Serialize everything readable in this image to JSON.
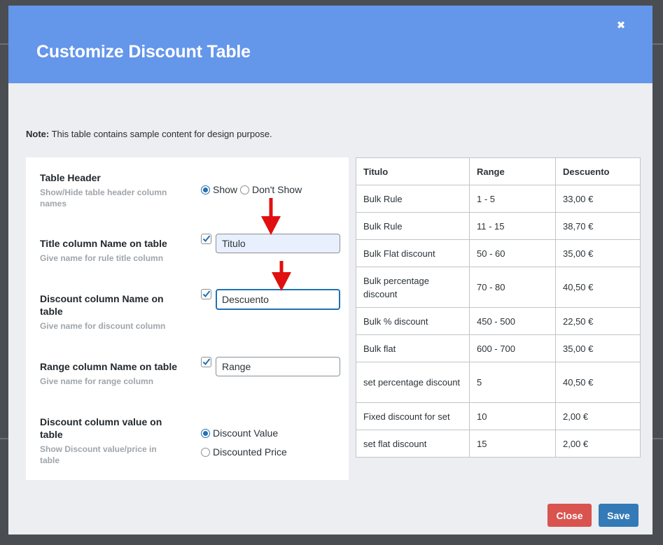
{
  "modal": {
    "title": "Customize Discount Table",
    "note_prefix": "Note:",
    "note_text": " This table contains sample content for design purpose."
  },
  "settings": {
    "table_header": {
      "label": "Table Header",
      "desc": "Show/Hide table header column names",
      "option_show": "Show",
      "option_dont_show": "Don't Show",
      "selected": "Show"
    },
    "title_column": {
      "label": "Title column Name on table",
      "desc": "Give name for rule title column",
      "checked": true,
      "value": "Titulo"
    },
    "discount_column": {
      "label": "Discount column Name on table",
      "desc": "Give name for discount column",
      "checked": true,
      "value": "Descuento"
    },
    "range_column": {
      "label": "Range column Name on table",
      "desc": "Give name for range column",
      "checked": true,
      "value": "Range"
    },
    "discount_value": {
      "label": "Discount column value on table",
      "desc": "Show Discount value/price in table",
      "option_value": "Discount Value",
      "option_price": "Discounted Price",
      "selected": "Discount Value"
    }
  },
  "preview": {
    "headers": [
      "Titulo",
      "Range",
      "Descuento"
    ],
    "rows": [
      [
        "Bulk Rule",
        "1 - 5",
        "33,00 €"
      ],
      [
        "Bulk Rule",
        "11 - 15",
        "38,70 €"
      ],
      [
        "Bulk Flat discount",
        "50 - 60",
        "35,00 €"
      ],
      [
        "Bulk percentage discount",
        "70 - 80",
        "40,50 €"
      ],
      [
        "Bulk % discount",
        "450 - 500",
        "22,50 €"
      ],
      [
        "Bulk flat",
        "600 - 700",
        "35,00 €"
      ],
      [
        "set percentage discount",
        "5",
        "40,50 €"
      ],
      [
        "Fixed discount for set",
        "10",
        "2,00 €"
      ],
      [
        "set flat discount",
        "15",
        "2,00 €"
      ]
    ]
  },
  "buttons": {
    "close": "Close",
    "save": "Save"
  },
  "colors": {
    "header_bg": "#6496ea",
    "close_button": "#d9534f",
    "save_button": "#337ab7",
    "annotation_arrow": "#e01010"
  }
}
